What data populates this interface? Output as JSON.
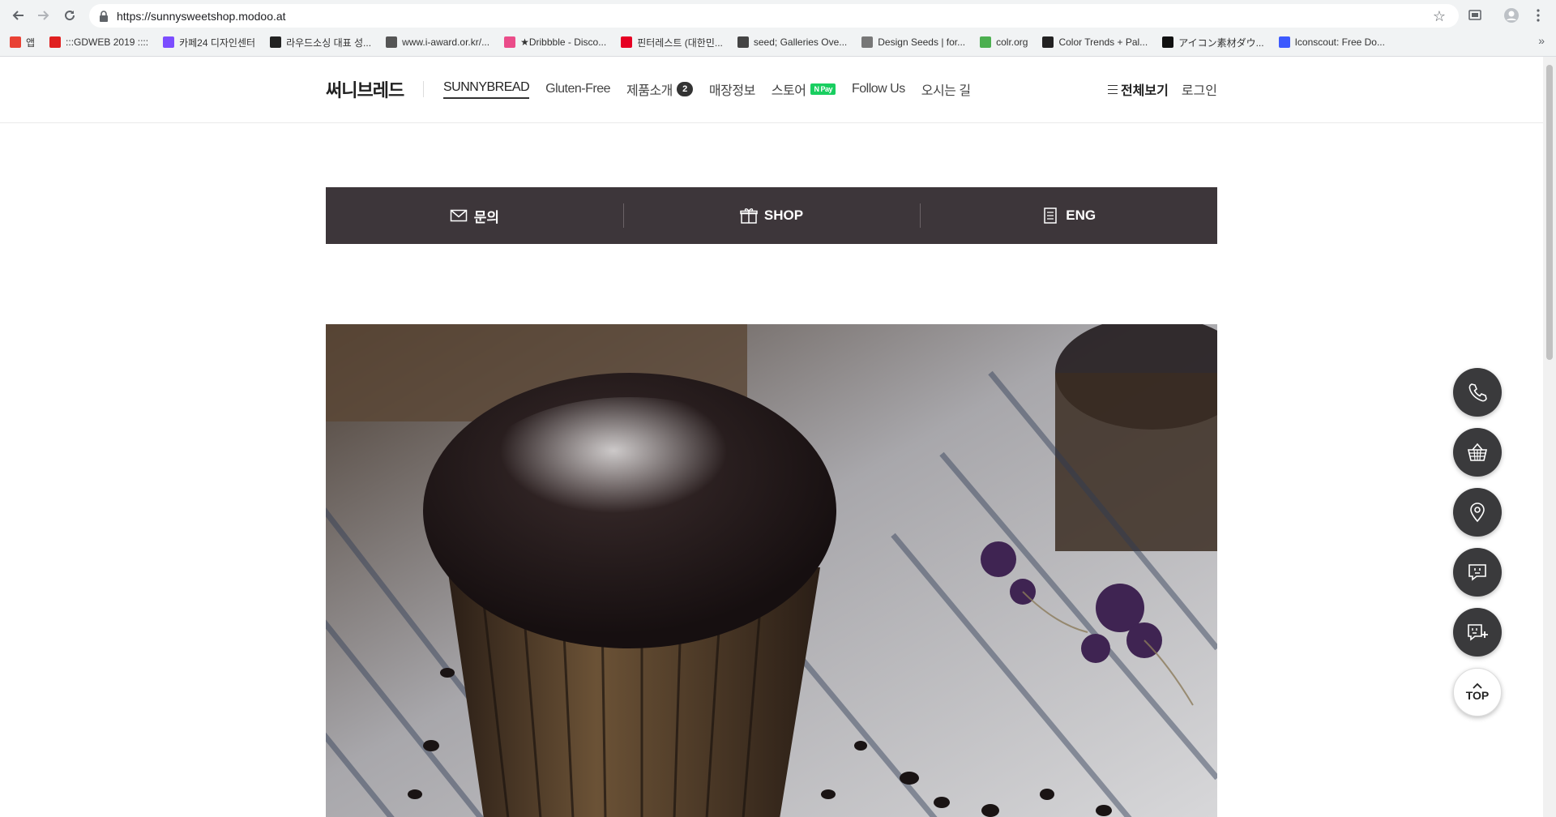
{
  "browser": {
    "url": "https://sunnysweetshop.modoo.at",
    "bookmarks": [
      {
        "label": "앱",
        "color": "#e94235"
      },
      {
        "label": ":::GDWEB 2019 ::::",
        "color": "#e02020"
      },
      {
        "label": "카페24 디자인센터",
        "color": "#7c4dff"
      },
      {
        "label": "라우드소싱 대표 성...",
        "color": "#222222"
      },
      {
        "label": "www.i-award.or.kr/...",
        "color": "#555555"
      },
      {
        "label": "★Dribbble - Disco...",
        "color": "#ea4c89"
      },
      {
        "label": "핀터레스트 (대한민...",
        "color": "#e60023"
      },
      {
        "label": "seed; Galleries Ove...",
        "color": "#444444"
      },
      {
        "label": "Design Seeds | for...",
        "color": "#777777"
      },
      {
        "label": "colr.org",
        "color": "#4caf50"
      },
      {
        "label": "Color Trends + Pal...",
        "color": "#222222"
      },
      {
        "label": "アイコン素材ダウ...",
        "color": "#111111"
      },
      {
        "label": "Iconscout: Free Do...",
        "color": "#3d5afe"
      }
    ],
    "more": "»"
  },
  "site": {
    "logo": "써니브레드",
    "nav": [
      {
        "label": "SUNNYBREAD",
        "active": true
      },
      {
        "label": "Gluten-Free"
      },
      {
        "label": "제품소개",
        "badge": "2"
      },
      {
        "label": "매장정보"
      },
      {
        "label": "스토어",
        "npay": "N Pay"
      },
      {
        "label": "Follow Us"
      },
      {
        "label": "오시는 길"
      }
    ],
    "all_view": "전체보기",
    "login": "로그인"
  },
  "quick_bar": {
    "inquiry": "문의",
    "shop": "SHOP",
    "eng": "ENG"
  },
  "floating": {
    "top_label": "TOP"
  },
  "colors": {
    "quick_bar_bg": "#3d363a",
    "floating_bg": "#3a3a3c",
    "npay_green": "#19ce60"
  }
}
